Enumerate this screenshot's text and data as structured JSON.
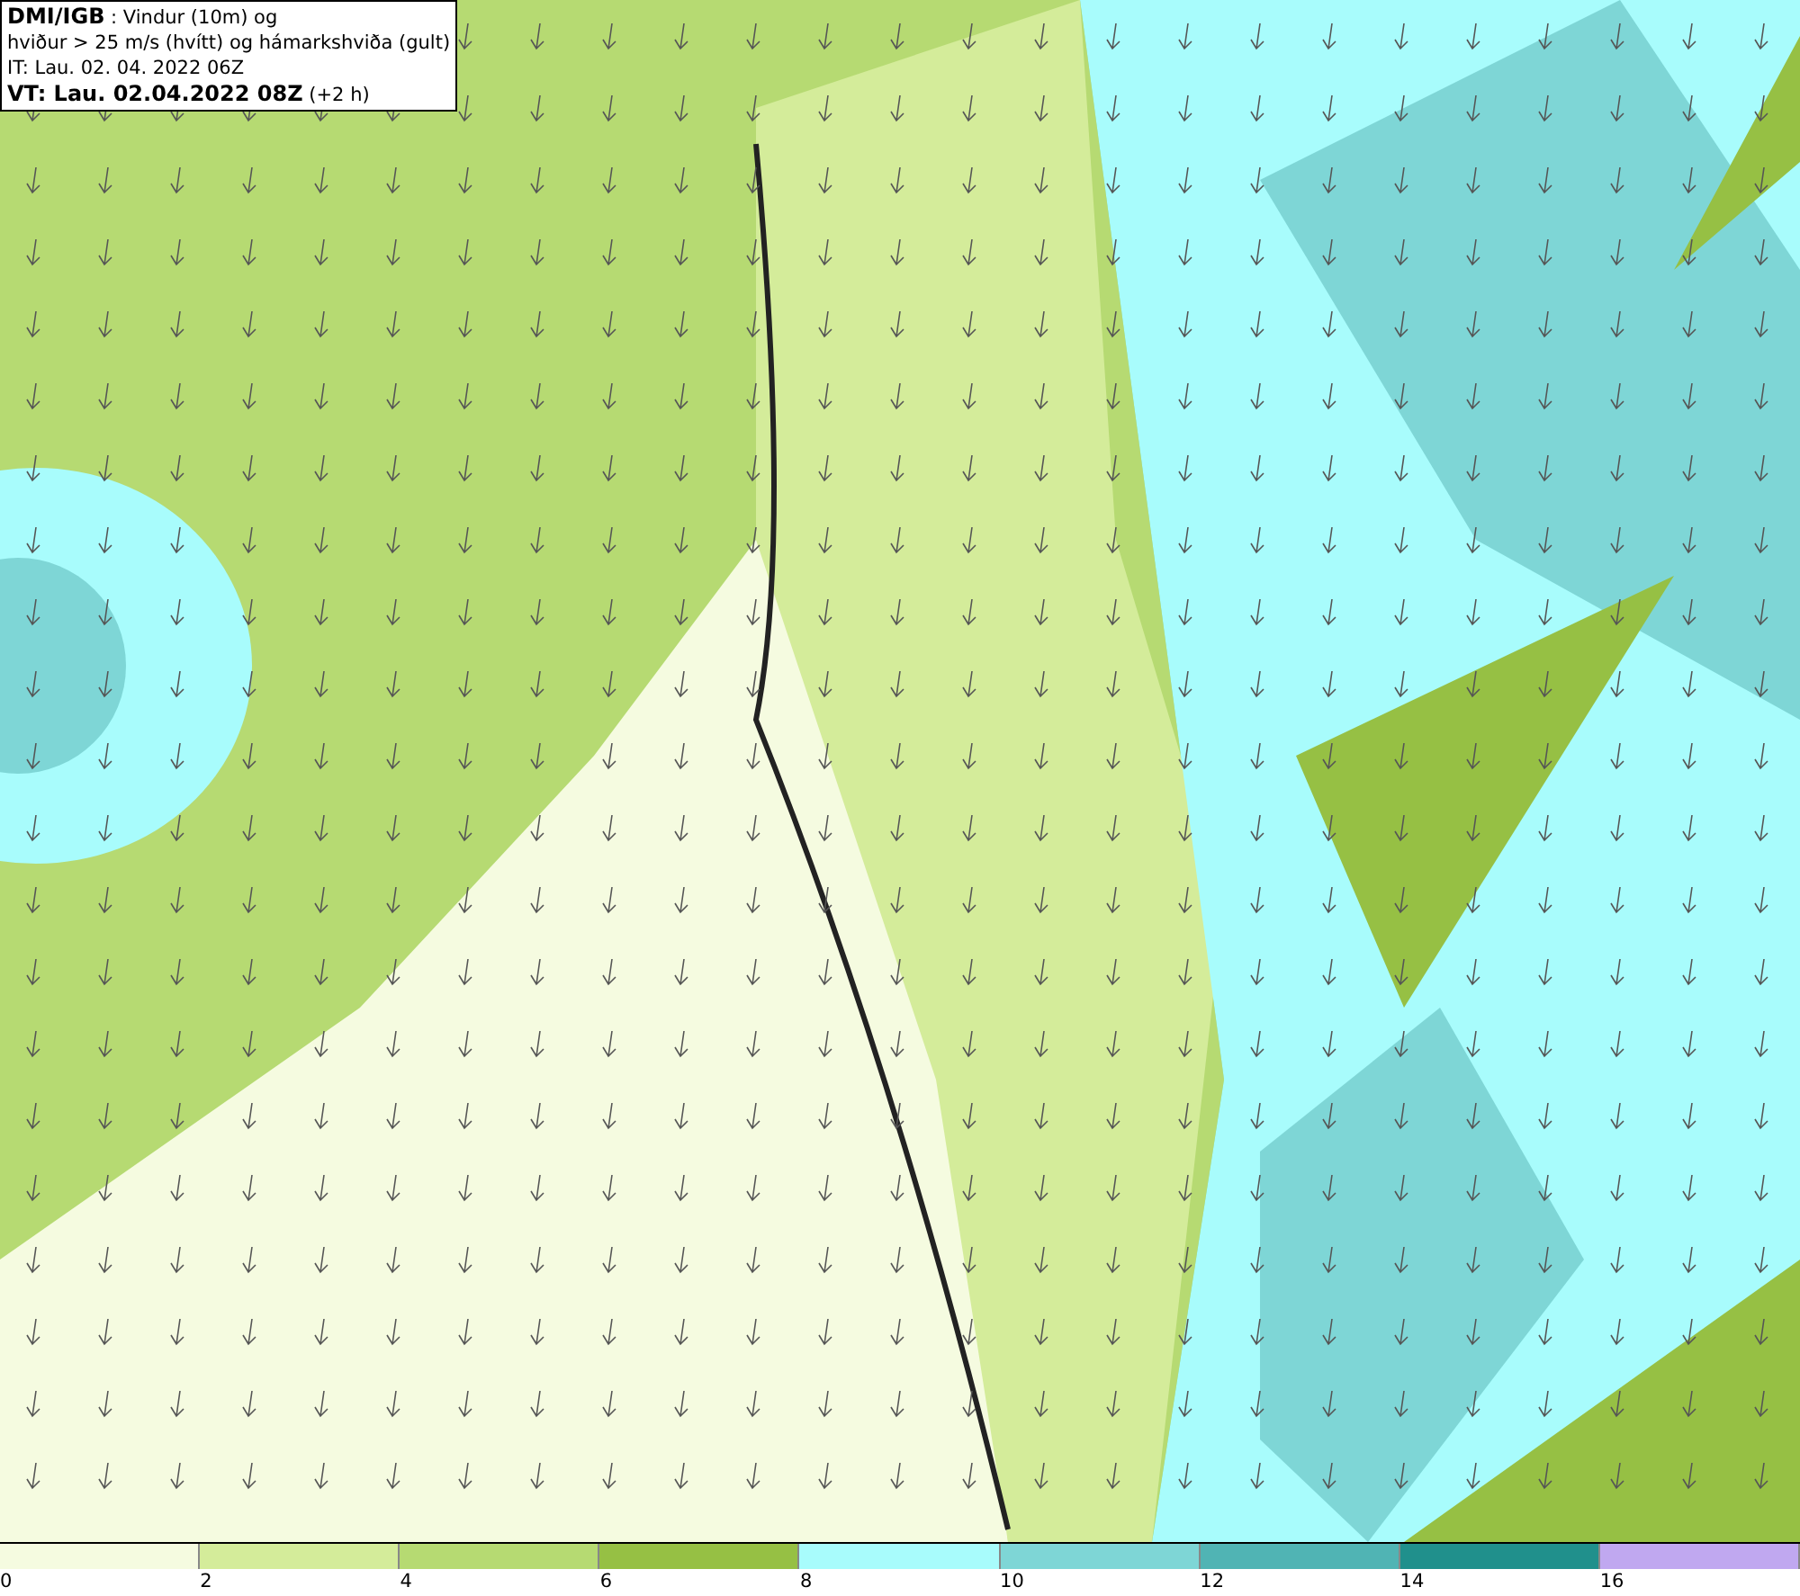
{
  "header": {
    "lines": [
      "**DMI/IGB** : Vindur (10m) og",
      "hviður > 25 m/s (hvítt) og hámarkshviða (gult)",
      "IT: Lau. 02. 04. 2022 06Z",
      "**VT: Lau. 02.04.2022 08Z** (+2 h)"
    ]
  },
  "legend": [
    {
      "label": "0",
      "color": "#f5fbe0"
    },
    {
      "label": "2",
      "color": "#d4ec9a"
    },
    {
      "label": "4",
      "color": "#b6da72"
    },
    {
      "label": "6",
      "color": "#96c044"
    },
    {
      "label": "8",
      "color": "#a8fcfc"
    },
    {
      "label": "10",
      "color": "#7ed6d6"
    },
    {
      "label": "12",
      "color": "#50b4b4"
    },
    {
      "label": "14",
      "color": "#20908c"
    },
    {
      "label": "16",
      "color": "#c0a8f0"
    }
  ]
}
